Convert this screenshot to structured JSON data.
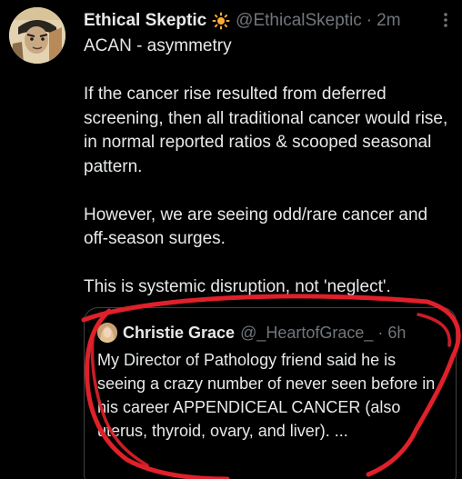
{
  "author": {
    "name": "Ethical Skeptic",
    "emoji_icon": "sun-icon",
    "handle": "@EthicalSkeptic",
    "separator": "·",
    "time": "2m"
  },
  "tweet": {
    "paragraphs": [
      "ACAN - asymmetry",
      "If the cancer rise resulted from deferred screening, then all traditional cancer would rise, in normal reported ratios & scooped seasonal pattern.",
      "However, we are seeing odd/rare cancer and off-season surges.",
      "This is systemic disruption, not 'neglect'."
    ]
  },
  "quoted": {
    "name": "Christie Grace",
    "handle": "@_HeartofGrace_",
    "separator": "·",
    "time": "6h",
    "text": "My Director of Pathology friend said he is seeing a crazy number of never seen before in his career APPENDICEAL CANCER (also uterus, thyroid, ovary, and liver). ..."
  },
  "colors": {
    "background": "#000000",
    "text": "#e7e9ea",
    "muted": "#71767b",
    "border": "#3e4144",
    "sun": "#ffac33",
    "annotation": "#e0202a"
  }
}
